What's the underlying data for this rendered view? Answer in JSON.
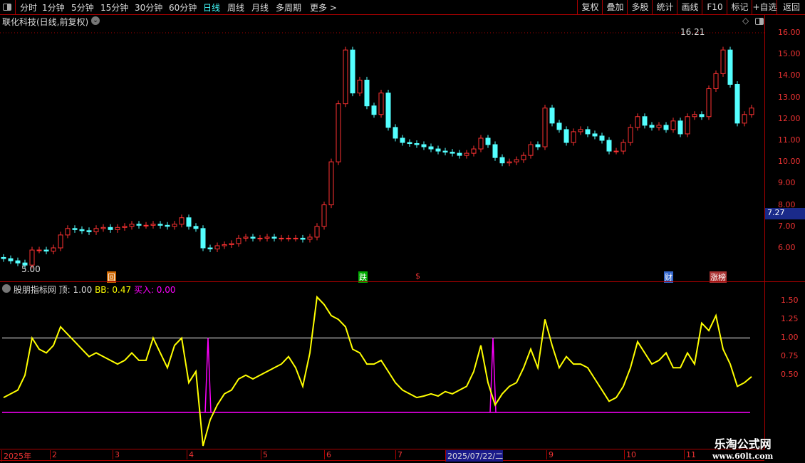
{
  "toolbar": {
    "periods": [
      "分时",
      "1分钟",
      "5分钟",
      "15分钟",
      "30分钟",
      "60分钟",
      "日线",
      "周线",
      "月线",
      "多周期",
      "更多 >"
    ],
    "active": "日线",
    "right_buttons": [
      "复权",
      "叠加",
      "多股",
      "统计",
      "画线",
      "F10",
      "标记",
      "+自选",
      "返回"
    ]
  },
  "stock": {
    "title": "联化科技(日线,前复权)",
    "high_label": "16.21",
    "low_label": "5.00",
    "current_price": "7.27"
  },
  "price_axis": [
    "16.00",
    "15.00",
    "14.00",
    "13.00",
    "12.00",
    "11.00",
    "10.00",
    "9.00",
    "8.00",
    "7.00",
    "6.00"
  ],
  "markers": [
    {
      "label": "回",
      "color": "#c60"
    },
    {
      "label": "跌",
      "color": "#0a0"
    },
    {
      "label": "$",
      "color": "#e33"
    },
    {
      "label": "财",
      "color": "#36c"
    },
    {
      "label": "涨榜",
      "color": "#a33"
    }
  ],
  "indicator": {
    "name": "股朋指标网",
    "top_label": "顶: 1.00",
    "bb_label": "BB: 0.47",
    "buy_label": "买入: 0.00",
    "axis": [
      "1.50",
      "1.25",
      "1.00",
      "0.75",
      "0.50"
    ]
  },
  "dates": [
    "2025年",
    "2",
    "3",
    "4",
    "5",
    "6",
    "7",
    "2025/07/22/二",
    "9",
    "10",
    "11"
  ],
  "watermark": {
    "line1": "乐淘公式网",
    "line2": "www.60lt.com"
  },
  "colors": {
    "up": "#ff3232",
    "down": "#54ffff",
    "bb": "#ffff00",
    "buy": "#ff00ff",
    "top": "#ffffff"
  },
  "chart_data": {
    "type": "candlestick",
    "closes": [
      5.5,
      5.4,
      5.3,
      5.2,
      5.9,
      5.9,
      5.85,
      6.0,
      6.6,
      6.9,
      6.85,
      6.8,
      6.75,
      6.9,
      6.95,
      6.85,
      6.95,
      7.0,
      7.1,
      7.05,
      7.05,
      7.1,
      7.05,
      7.0,
      7.1,
      7.4,
      7.0,
      6.9,
      6.0,
      5.95,
      6.1,
      6.15,
      6.2,
      6.45,
      6.5,
      6.45,
      6.45,
      6.5,
      6.45,
      6.45,
      6.45,
      6.45,
      6.4,
      6.5,
      7.0,
      8.0,
      10.0,
      12.7,
      15.2,
      13.2,
      13.8,
      12.6,
      12.2,
      13.2,
      11.6,
      11.1,
      10.9,
      10.85,
      10.8,
      10.7,
      10.6,
      10.5,
      10.45,
      10.4,
      10.3,
      10.4,
      10.6,
      11.1,
      10.8,
      10.2,
      9.95,
      10.0,
      10.1,
      10.3,
      10.8,
      10.7,
      12.5,
      11.8,
      11.5,
      10.9,
      11.4,
      11.5,
      11.3,
      11.2,
      11.0,
      10.5,
      10.5,
      10.9,
      11.6,
      12.1,
      11.7,
      11.6,
      11.7,
      11.5,
      11.9,
      11.3,
      12.1,
      12.2,
      12.1,
      13.4,
      14.1,
      15.2,
      13.6,
      11.8,
      12.2,
      12.5
    ],
    "bb": [
      0.2,
      0.25,
      0.3,
      0.5,
      1.0,
      0.85,
      0.8,
      0.9,
      1.15,
      1.05,
      0.95,
      0.85,
      0.75,
      0.8,
      0.75,
      0.7,
      0.65,
      0.7,
      0.8,
      0.7,
      0.7,
      1.0,
      0.8,
      0.6,
      0.9,
      1.0,
      0.4,
      0.55,
      -0.45,
      -0.1,
      0.1,
      0.25,
      0.3,
      0.45,
      0.5,
      0.45,
      0.5,
      0.55,
      0.6,
      0.65,
      0.75,
      0.6,
      0.35,
      0.8,
      1.55,
      1.45,
      1.3,
      1.25,
      1.15,
      0.85,
      0.8,
      0.65,
      0.65,
      0.7,
      0.55,
      0.4,
      0.3,
      0.25,
      0.2,
      0.22,
      0.25,
      0.22,
      0.28,
      0.25,
      0.3,
      0.35,
      0.55,
      0.9,
      0.4,
      0.1,
      0.25,
      0.35,
      0.4,
      0.6,
      0.85,
      0.6,
      1.25,
      0.9,
      0.6,
      0.75,
      0.65,
      0.65,
      0.6,
      0.45,
      0.3,
      0.15,
      0.2,
      0.35,
      0.6,
      0.95,
      0.8,
      0.65,
      0.7,
      0.8,
      0.6,
      0.6,
      0.8,
      0.65,
      1.2,
      1.1,
      1.3,
      0.85,
      0.65,
      0.35,
      0.4,
      0.48
    ],
    "buy_signal_index": [
      29,
      69
    ],
    "top_level": 1.0,
    "buy_level": 0.0,
    "price_range": [
      5,
      16.5
    ],
    "indicator_range": [
      -0.5,
      1.7
    ]
  }
}
